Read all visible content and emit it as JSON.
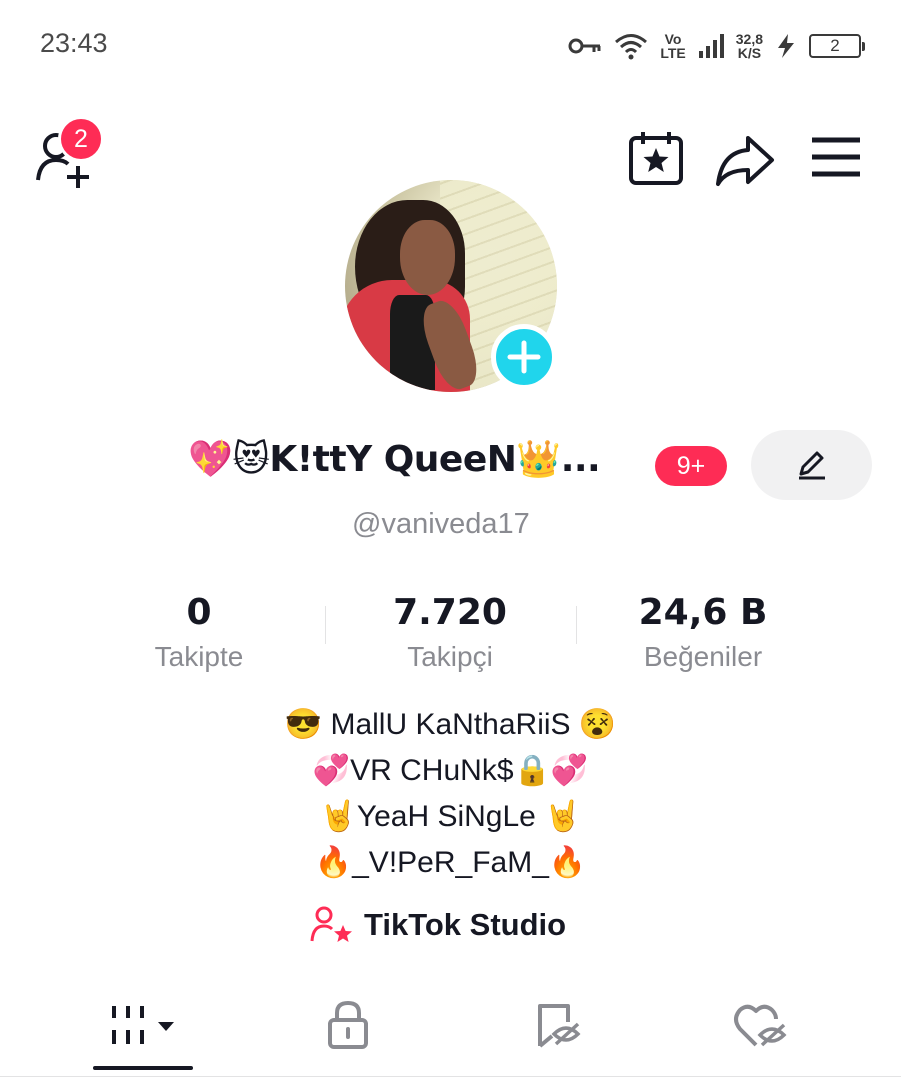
{
  "status_bar": {
    "time": "23:43",
    "network_top": "Vo",
    "network_bottom": "LTE",
    "speed_top": "32,8",
    "speed_bottom": "K/S",
    "battery": "2",
    "icons": [
      "key-icon",
      "wifi-icon",
      "signal-icon",
      "charging-icon",
      "battery-icon"
    ]
  },
  "header": {
    "notification_count": "2",
    "icons": [
      "add-friend-icon",
      "calendar-star-icon",
      "share-icon",
      "menu-icon"
    ]
  },
  "profile": {
    "display_name": "💖😻K!ttY QueeN👑...",
    "name_badge": "9+",
    "username": "@vaniveda17"
  },
  "stats": [
    {
      "value": "0",
      "label": "Takipte"
    },
    {
      "value": "7.720",
      "label": "Takipçi"
    },
    {
      "value": "24,6 B",
      "label": "Beğeniler"
    }
  ],
  "bio": [
    "😎 MallU KaNthaRiiS 😵",
    "💞VR CHuNk$🔒💞",
    "🤘YeaH SiNgLe 🤘",
    "🔥_V!PeR_FaM_🔥"
  ],
  "studio": {
    "label": "TikTok Studio",
    "accent": "#fe2c55"
  },
  "tabs": [
    "videos-grid-icon",
    "private-lock-icon",
    "reposts-icon",
    "liked-hidden-icon"
  ],
  "colors": {
    "accent": "#fe2c55",
    "cyan": "#20d5ec",
    "text": "#161823",
    "muted": "#8a8b91"
  }
}
